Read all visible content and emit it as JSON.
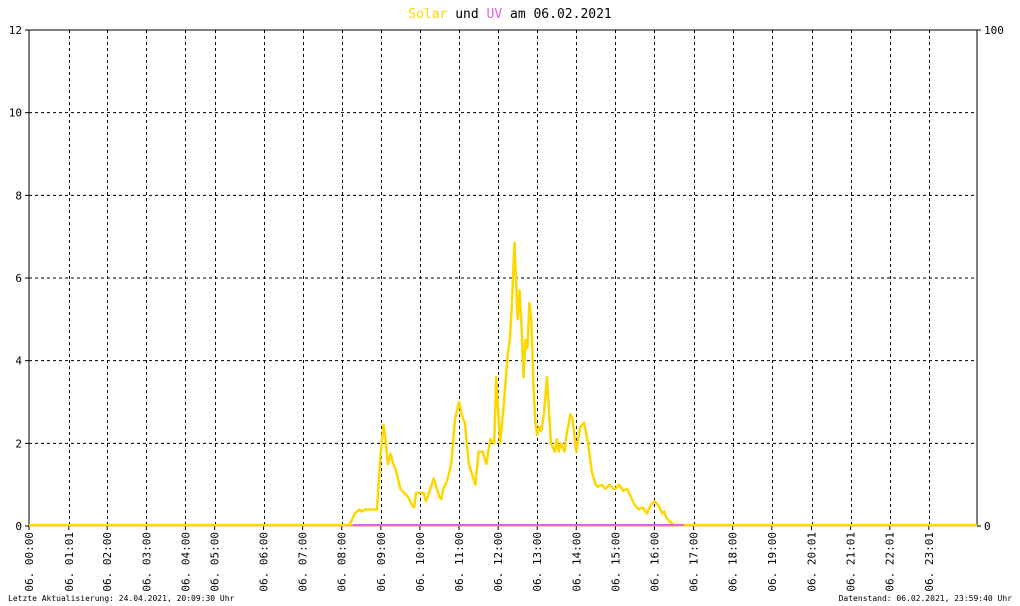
{
  "chart_data": {
    "type": "line",
    "title": {
      "part1": "Solar",
      "part2": " und ",
      "part3": "UV",
      "part4": " am 06.02.2021",
      "color1": "#ffd700",
      "color3": "#dd66dd"
    },
    "x_tick_labels": [
      "06. 00:00",
      "06. 01:01",
      "06. 02:00",
      "06. 03:00",
      "06. 04:00",
      "06. 05:00",
      "06. 06:00",
      "06. 07:00",
      "06. 08:00",
      "06. 09:00",
      "06. 10:00",
      "06. 11:00",
      "06. 12:00",
      "06. 13:00",
      "06. 14:00",
      "06. 15:00",
      "06. 16:00",
      "06. 17:00",
      "06. 18:00",
      "06. 19:00",
      "06. 20:01",
      "06. 21:01",
      "06. 22:01",
      "06. 23:01"
    ],
    "x_tick_hours": [
      0,
      1.017,
      2,
      3,
      4,
      4.75,
      6,
      7,
      8,
      9,
      10,
      11,
      12,
      13,
      14,
      15,
      16,
      17,
      18,
      19,
      20.017,
      21.017,
      22.017,
      23.017
    ],
    "xlim": [
      0,
      24.25
    ],
    "ylim_left": [
      0,
      12
    ],
    "ylim_right": [
      0,
      100
    ],
    "yticks_left": [
      0,
      2,
      4,
      6,
      8,
      10,
      12
    ],
    "yticks_right": [
      0,
      100
    ],
    "grid": true,
    "series": [
      {
        "name": "Solar",
        "color": "#ffd700",
        "x": [
          0,
          8.2,
          8.33,
          8.45,
          8.5,
          8.6,
          8.75,
          8.9,
          9.0,
          9.07,
          9.12,
          9.18,
          9.25,
          9.32,
          9.37,
          9.42,
          9.5,
          9.6,
          9.7,
          9.8,
          9.85,
          9.9,
          10.0,
          10.1,
          10.15,
          10.2,
          10.3,
          10.35,
          10.4,
          10.5,
          10.55,
          10.6,
          10.7,
          10.8,
          10.9,
          11.0,
          11.1,
          11.15,
          11.2,
          11.25,
          11.3,
          11.35,
          11.42,
          11.5,
          11.6,
          11.7,
          11.8,
          11.9,
          11.95,
          12.05,
          12.15,
          12.25,
          12.3,
          12.35,
          12.42,
          12.5,
          12.55,
          12.6,
          12.65,
          12.7,
          12.75,
          12.8,
          12.85,
          12.9,
          12.95,
          13.0,
          13.05,
          13.1,
          13.17,
          13.25,
          13.35,
          13.45,
          13.5,
          13.55,
          13.6,
          13.65,
          13.7,
          13.75,
          13.85,
          13.9,
          14.0,
          14.1,
          14.2,
          14.3,
          14.4,
          14.5,
          14.55,
          14.65,
          14.75,
          14.85,
          14.95,
          15.0,
          15.1,
          15.2,
          15.3,
          15.4,
          15.5,
          15.6,
          15.7,
          15.8,
          15.9,
          16.0,
          16.1,
          16.2,
          16.25,
          16.3,
          16.4,
          16.5,
          16.6,
          16.65,
          16.7,
          24.25
        ],
        "values": [
          0,
          0,
          0.3,
          0.4,
          0.35,
          0.4,
          0.4,
          0.4,
          1.8,
          2.45,
          2.1,
          1.5,
          1.75,
          1.5,
          1.4,
          1.2,
          0.9,
          0.8,
          0.7,
          0.5,
          0.45,
          0.8,
          0.8,
          0.8,
          0.6,
          0.7,
          1.0,
          1.15,
          1.0,
          0.7,
          0.65,
          0.9,
          1.1,
          1.5,
          2.6,
          3.0,
          2.6,
          2.5,
          2.0,
          1.5,
          1.35,
          1.2,
          1.0,
          1.8,
          1.8,
          1.5,
          2.1,
          2.0,
          3.6,
          2.0,
          3.0,
          4.2,
          4.5,
          5.3,
          6.85,
          5.0,
          5.7,
          4.8,
          3.6,
          4.5,
          4.3,
          5.4,
          5.0,
          3.5,
          2.5,
          2.2,
          2.4,
          2.3,
          2.7,
          3.6,
          2.0,
          1.8,
          2.1,
          1.8,
          2.0,
          1.9,
          1.8,
          2.2,
          2.7,
          2.6,
          1.8,
          2.4,
          2.5,
          2.0,
          1.3,
          1.0,
          0.95,
          1.0,
          0.9,
          1.0,
          0.9,
          0.9,
          1.0,
          0.85,
          0.9,
          0.7,
          0.5,
          0.4,
          0.45,
          0.3,
          0.5,
          0.6,
          0.5,
          0.3,
          0.35,
          0.2,
          0.1,
          0,
          0,
          0,
          0,
          0
        ]
      },
      {
        "name": "UV",
        "color": "#dd66dd",
        "x": [
          8.3,
          16.75
        ],
        "values": [
          0,
          0
        ]
      }
    ],
    "baseline_color": "#ff8080"
  },
  "footer": {
    "left": "Letzte Aktualisierung: 24.04.2021, 20:09:30 Uhr",
    "right": "Datenstand: 06.02.2021, 23:59:40 Uhr"
  }
}
